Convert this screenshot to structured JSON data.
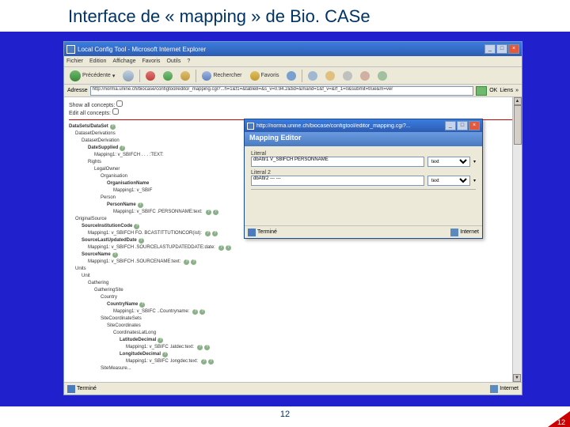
{
  "slide": {
    "title": "Interface de « mapping » de Bio. CASe",
    "page_num": "12",
    "page_num_red": "12"
  },
  "ie": {
    "title": "Local Config Tool - Microsoft Internet Explorer",
    "menu": [
      "Fichier",
      "Edition",
      "Affichage",
      "Favoris",
      "Outils",
      "?"
    ],
    "toolbar": {
      "back": "Précédente",
      "search": "Rechercher",
      "favorites": "Favoris"
    },
    "address_label": "Adresse",
    "address_url": "http://norma.unine.ch/biocase/configtool/editor_mapping.cgi?...h=1&f1=&table8=&s_v=0.94.2&tid=&mand=1&f_v=&rf_1=0&submit=true&m=ver",
    "go": "OK",
    "links": "Liens",
    "content": {
      "line1": "Show all concepts:",
      "line2": "Edit all concepts:"
    },
    "status_left": "Terminé",
    "status_right": "Internet"
  },
  "tree": {
    "root": "DataSets/DataSet",
    "n1": "DatasetDerivations",
    "n2": "DatasetDerivation",
    "n3": "DateSupplied",
    "m1": "Mapping1: v_SBIFCH .  . . :TEXT:",
    "n4": "Rights",
    "n5": "LegalOwner",
    "n6": "Organisation",
    "n7": "OrganisationName",
    "m2": "Mapping1: v_SBIF",
    "n8": "Person",
    "n9": "PersonName",
    "m3": "Mapping1: v_SBIFC .PERSONNAME:text:",
    "n10": "OriginalSource",
    "n11": "SourceInstitutionCode",
    "m4": "Mapping1: v_SBIFCH FO. BCASTITTUTIONCOR(ist):",
    "n12": "SourceLastUpdatedDate",
    "m5": "Mapping1: v_SBIFCH .SOURCELASTUPDATEDDATE:date:",
    "n13": "SourceName",
    "m6": "Mapping1: v_SBIFCH .SOURCENAME:text:",
    "n14": "Units",
    "n15": "Unit",
    "n16": "Gathering",
    "n17": "GatheringSite",
    "n18": "Country",
    "n19": "CountryName",
    "m7": "Mapping1: v_SBIFC ..Countryname:",
    "n20": "SiteCoordinateSets",
    "n21": "SiteCoordinates",
    "n22": "CoordinatesLatLong",
    "n23": "LatitudeDecimal",
    "m8": "Mapping1: v_SBIFC .latdec:text:",
    "n24": "LongitudeDecimal",
    "m9": "Mapping1: v_SBIFC .longdec:text:",
    "n25": "SiteMeasure..."
  },
  "popup": {
    "titlebar": "http://norma.unine.ch/biocase/configtool/editor_mapping.cgi?...",
    "header": "Mapping Editor",
    "label1": "Literal",
    "input1": "dbAttr1  V_SBIFCH        PERSONNAME",
    "select1": "text",
    "label2": "Literal 2",
    "input2": "dbAttr2  ---  ---",
    "select2": "text",
    "status_left": "Terminé",
    "status_right": "Internet"
  }
}
